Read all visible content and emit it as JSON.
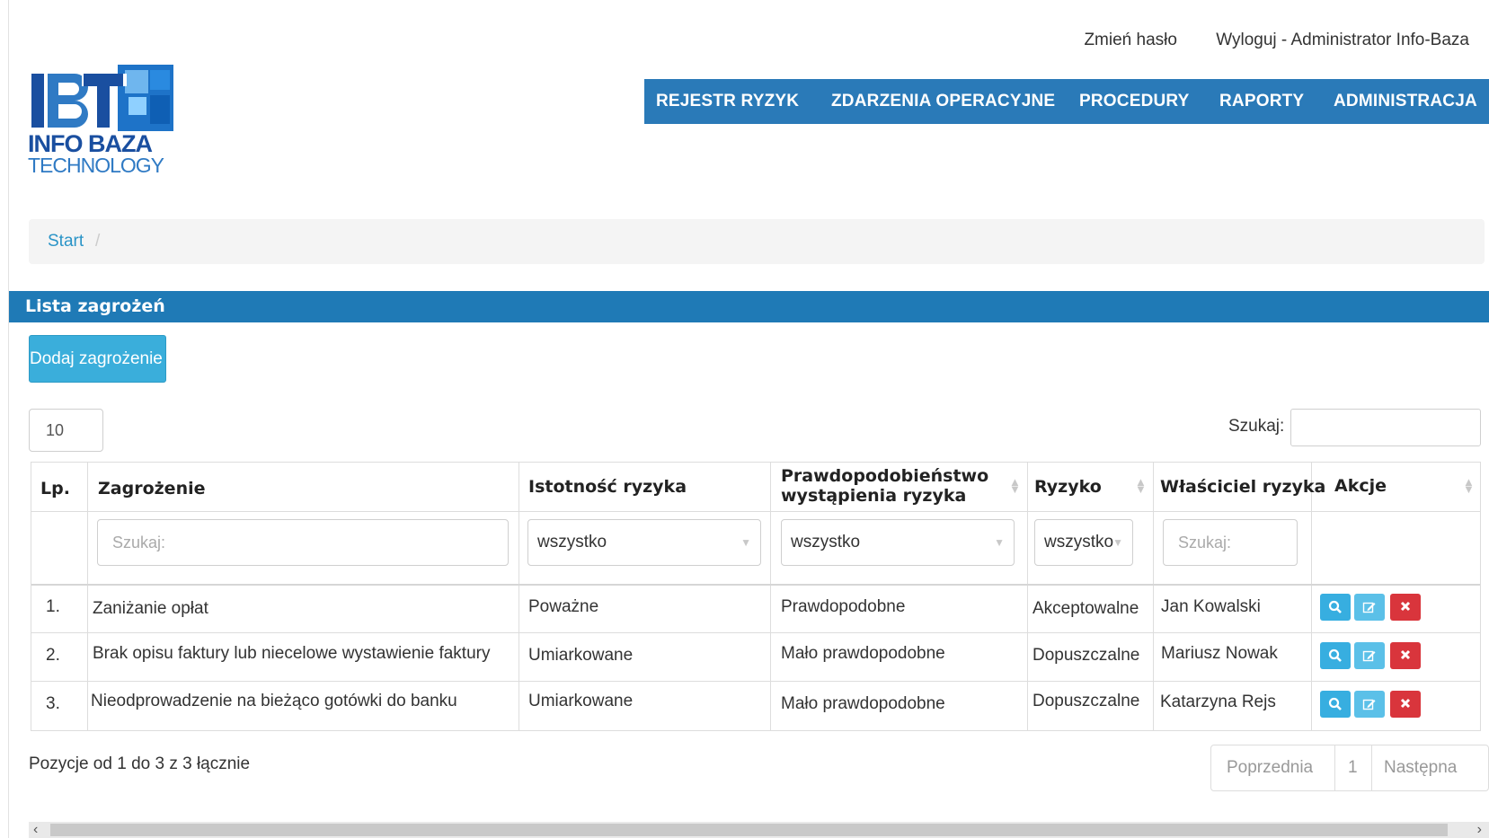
{
  "header": {
    "change_password": "Zmień hasło",
    "logout": "Wyloguj - Administrator Info-Baza"
  },
  "logo": {
    "line1": "INFO BAZA",
    "line2": "TECHNOLOGY",
    "colors": {
      "dark": "#1a4fa0",
      "light": "#2f7ac4"
    }
  },
  "nav": {
    "items": [
      "REJESTR RYZYK",
      "ZDARZENIA OPERACYJNE",
      "PROCEDURY",
      "RAPORTY",
      "ADMINISTRACJA"
    ],
    "color": "#2a7ab8"
  },
  "breadcrumb": {
    "start": "Start",
    "separator": "/"
  },
  "panel": {
    "title": "Lista zagrożeń",
    "add_button": "Dodaj zagrożenie"
  },
  "controls": {
    "page_size": "10",
    "search_label": "Szukaj:",
    "search_value": ""
  },
  "table": {
    "columns": [
      "Lp.",
      "Zagrożenie",
      "Istotność ryzyka",
      "Prawdopodobieństwo wystąpienia ryzyka",
      "Ryzyko",
      "Właściciel ryzyka",
      "Akcje"
    ],
    "filters": {
      "threat_placeholder": "Szukaj:",
      "severity": "wszystko",
      "probability": "wszystko",
      "risk": "wszystko",
      "owner_placeholder": "Szukaj:"
    },
    "rows": [
      {
        "lp": "1.",
        "threat": "Zaniżanie opłat",
        "severity": "Poważne",
        "probability": "Prawdopodobne",
        "risk": "Akceptowalne",
        "owner": "Jan Kowalski"
      },
      {
        "lp": "2.",
        "threat": "Brak opisu faktury lub niecelowe wystawienie faktury",
        "severity": "Umiarkowane",
        "probability": "Mało prawdopodobne",
        "risk": "Dopuszczalne",
        "owner": "Mariusz Nowak"
      },
      {
        "lp": "3.",
        "threat": "Nieodprowadzenie na bieżąco gotówki do banku",
        "severity": "Umiarkowane",
        "probability": "Mało prawdopodobne",
        "risk": "Dopuszczalne",
        "owner": "Katarzyna Rejs"
      }
    ],
    "action_icons": [
      "search-icon",
      "edit-icon",
      "delete-icon"
    ]
  },
  "footer": {
    "info": "Pozycje od 1 do 3 z 3 łącznie",
    "prev": "Poprzednia",
    "page": "1",
    "next": "Następna"
  }
}
